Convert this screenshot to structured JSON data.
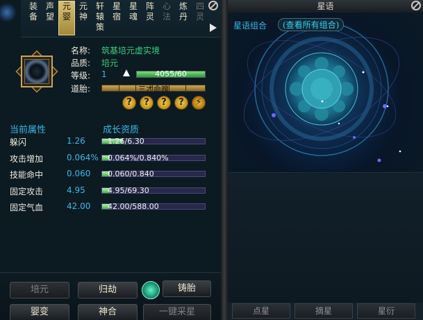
{
  "tabs": [
    {
      "label": "装\n备",
      "state": "normal"
    },
    {
      "label": "声\n望",
      "state": "normal"
    },
    {
      "label": "元\n婴",
      "state": "active"
    },
    {
      "label": "元\n神",
      "state": "normal"
    },
    {
      "label": "轩\n辕\n策",
      "state": "normal"
    },
    {
      "label": "星\n宿",
      "state": "normal"
    },
    {
      "label": "星\n魂",
      "state": "normal"
    },
    {
      "label": "阵\n灵",
      "state": "normal"
    },
    {
      "label": "心\n法",
      "state": "dim"
    },
    {
      "label": "炼\n丹",
      "state": "normal"
    },
    {
      "label": "四\n灵",
      "state": "dim"
    }
  ],
  "item": {
    "name_label": "名称:",
    "name_value": "筑基培元虚实境",
    "quality_label": "品质:",
    "quality_value": "培元",
    "level_label": "等级:",
    "level_value": "1",
    "exp_text": "4055/60",
    "exp_fill": 1.0,
    "embryo_label": "道胎:",
    "embryo_text": "三才命魄"
  },
  "attributes": {
    "current_title": "当前属性",
    "growth_title": "成长资质",
    "rows": [
      {
        "name": "躲闪",
        "value": "1.26",
        "bar_text": "1.26/6.30",
        "fill": 0.2
      },
      {
        "name": "攻击增加",
        "value": "0.064%",
        "bar_text": "0.064%/0.840%",
        "fill": 0.076
      },
      {
        "name": "技能命中",
        "value": "0.060",
        "bar_text": "0.060/0.840",
        "fill": 0.071
      },
      {
        "name": "固定攻击",
        "value": "4.95",
        "bar_text": "4.95/69.30",
        "fill": 0.071
      },
      {
        "name": "固定气血",
        "value": "42.00",
        "bar_text": "42.00/588.00",
        "fill": 0.071
      }
    ]
  },
  "buttons": {
    "peiyuan": "培元",
    "guijie": "归劫",
    "zhutai": "铸胎",
    "yingbian": "婴变",
    "shenhe": "神合",
    "yijian": "一键采星"
  },
  "right": {
    "title": "星语",
    "combo_label": "星语组合",
    "combo_link": "(查看所有组合)",
    "dianxing": "点星",
    "zhaixing": "摘星",
    "xingyan": "星衍"
  },
  "colors": {
    "accent_cyan": "#38b9e6",
    "value_green": "#38d17a",
    "gold": "#c9a45a"
  }
}
